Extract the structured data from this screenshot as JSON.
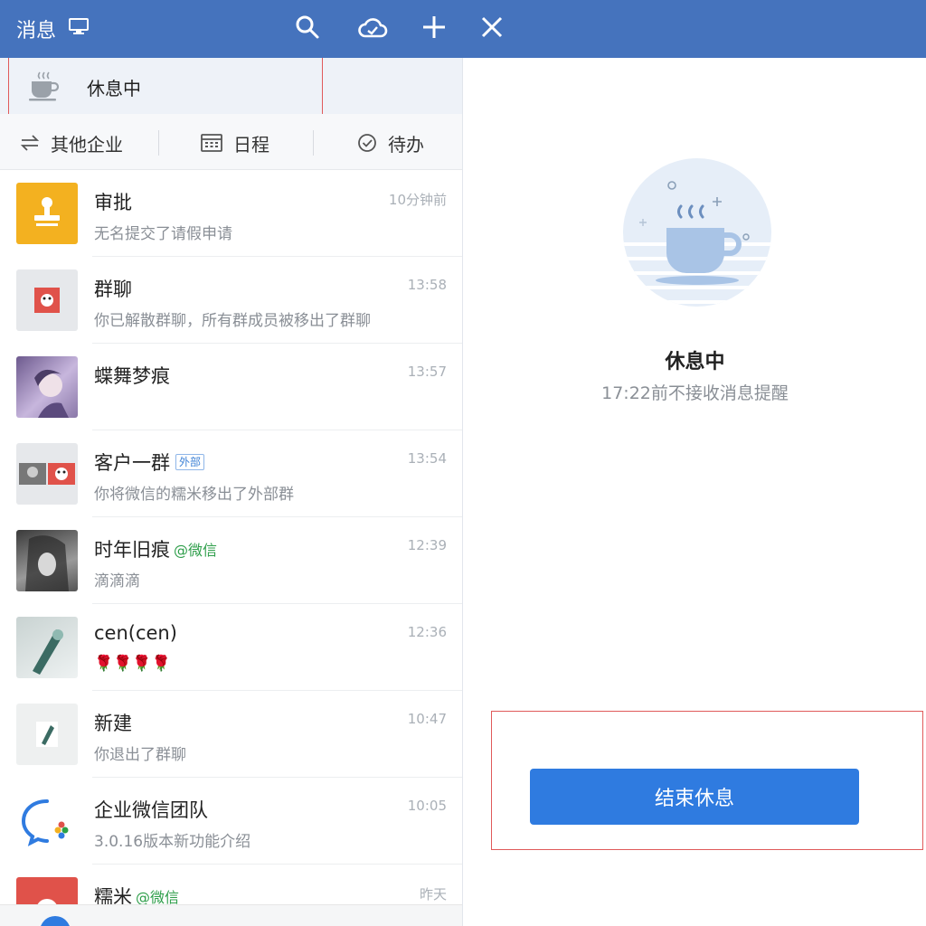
{
  "header": {
    "title": "消息",
    "icons": [
      "monitor-icon",
      "search-icon",
      "cloud-icon",
      "plus-icon",
      "close-icon"
    ],
    "color": "#4573bd"
  },
  "status": {
    "label": "休息中",
    "icon": "coffee-cup-icon"
  },
  "quick_actions": [
    {
      "label": "其他企业",
      "icon": "switch-icon"
    },
    {
      "label": "日程",
      "icon": "calendar-icon"
    },
    {
      "label": "待办",
      "icon": "check-circle-icon"
    }
  ],
  "conversations": [
    {
      "name": "审批",
      "preview": "无名提交了请假申请",
      "time": "10分钟前"
    },
    {
      "name": "群聊",
      "preview": "你已解散群聊，所有群成员被移出了群聊",
      "time": "13:58"
    },
    {
      "name": "蝶舞梦痕",
      "preview": "",
      "time": "13:57"
    },
    {
      "name": "客户一群",
      "tag": "外部",
      "preview": "你将微信的糯米移出了外部群",
      "time": "13:54"
    },
    {
      "name": "时年旧痕",
      "tag": "@微信",
      "preview": "滴滴滴",
      "time": "12:39"
    },
    {
      "name": "cen(cen)",
      "preview": "🌹🌹🌹🌹",
      "time": "12:36"
    },
    {
      "name": "新建",
      "preview": "你退出了群聊",
      "time": "10:47"
    },
    {
      "name": "企业微信团队",
      "preview": "3.0.16版本新功能介绍",
      "time": "10:05"
    },
    {
      "name": "糯米",
      "tag": "@微信",
      "preview": "",
      "time": "昨天"
    }
  ],
  "rest_panel": {
    "title": "休息中",
    "subtitle": "17:22前不接收消息提醒",
    "end_button": "结束休息",
    "accent": "#2f7be0"
  }
}
